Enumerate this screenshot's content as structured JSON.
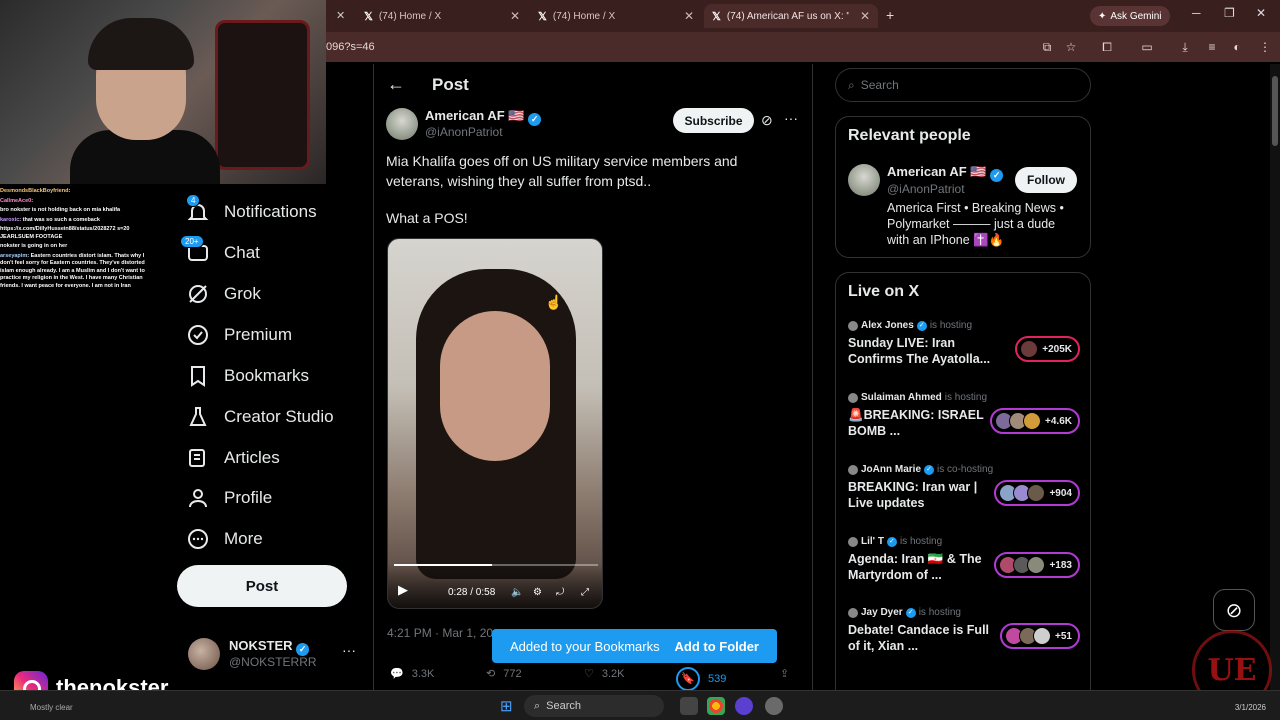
{
  "browser": {
    "tabs": [
      {
        "label": "(74) Home / X"
      },
      {
        "label": "(74) Home / X"
      },
      {
        "label": "(74) American AF us on X: \"Mia"
      }
    ],
    "url_fragment": "096?s=46",
    "gemini_label": "Ask Gemini"
  },
  "stream_chat": [
    {
      "user": "DesmondsBlackBoyfriend",
      "text": ""
    },
    {
      "user": "CallmeAce0",
      "text": ""
    },
    {
      "user": "",
      "text": "bro nokster is not holding back on mia khalifa"
    },
    {
      "user": "karoxic",
      "text": "that was so such a comeback"
    },
    {
      "user": "",
      "text": "https://x.com/DillyHussein88/status/2028272 s=20 JEARLSUEM FOOTAGE"
    },
    {
      "user": "",
      "text": "nokster is going in on her"
    },
    {
      "user": "arseyapim",
      "text": "Eastern countries distort islam. Thats why I don't feel sorry for Eastern countries. They've distorted islam enough already. I am a Muslim and I don't want to practice my religion in the West. I have many Christian friends. I want peace for everyone. I am not in Iran"
    }
  ],
  "nav": {
    "items": [
      {
        "label": "Notifications",
        "icon": "bell-icon",
        "badge": "4"
      },
      {
        "label": "Chat",
        "icon": "chat-icon",
        "badge": "20+"
      },
      {
        "label": "Grok",
        "icon": "grok-icon",
        "badge": ""
      },
      {
        "label": "Premium",
        "icon": "premium-icon",
        "badge": ""
      },
      {
        "label": "Bookmarks",
        "icon": "bookmark-icon",
        "badge": ""
      },
      {
        "label": "Creator Studio",
        "icon": "flask-icon",
        "badge": ""
      },
      {
        "label": "Articles",
        "icon": "articles-icon",
        "badge": ""
      },
      {
        "label": "Profile",
        "icon": "person-icon",
        "badge": ""
      },
      {
        "label": "More",
        "icon": "more-icon",
        "badge": ""
      }
    ],
    "post_button": "Post",
    "account": {
      "name": "NOKSTER",
      "handle": "@NOKSTERRR"
    }
  },
  "post": {
    "header": "Post",
    "author": {
      "name": "American AF 🇺🇸",
      "handle": "@iAnonPatriot"
    },
    "subscribe_label": "Subscribe",
    "text_line1": "Mia Khalifa goes off on US military service members and veterans, wishing they all suffer from ptsd..",
    "text_line2": "What a POS!",
    "video": {
      "time": "0:28 / 0:58",
      "progress": 0.48
    },
    "timestamp": "4:21 PM · Mar 1, 20",
    "toast": {
      "message": "Added to your Bookmarks",
      "action": "Add to Folder"
    },
    "stats": {
      "replies": "3.3K",
      "reposts": "772",
      "likes": "3.2K",
      "views": "539"
    }
  },
  "sidebar": {
    "search_placeholder": "Search",
    "relevant_title": "Relevant people",
    "relevant": {
      "name": "American AF 🇺🇸",
      "handle": "@iAnonPatriot",
      "follow_label": "Follow",
      "bio": "America First • Breaking News • Polymarket ——— just a dude with an IPhone ✝️🔥"
    },
    "live_title": "Live on X",
    "live": [
      {
        "host": "Alex Jones",
        "role": "is hosting",
        "title": "Sunday LIVE: Iran Confirms The Ayatolla...",
        "count": "+205K"
      },
      {
        "host": "Sulaiman Ahmed",
        "role": "is hosting",
        "title": "🚨BREAKING: ISRAEL BOMB ...",
        "count": "+4.6K"
      },
      {
        "host": "JoAnn Marie",
        "role": "is co-hosting",
        "title": "BREAKING: Iran war | Live updates",
        "count": "+904"
      },
      {
        "host": "Lil' T",
        "role": "is hosting",
        "title": "Agenda: Iran 🇮🇷 & The Martyrdom of ...",
        "count": "+183"
      },
      {
        "host": "Jay Dyer",
        "role": "is hosting",
        "title": "Debate! Candace is Full of it, Xian ...",
        "count": "+51"
      }
    ]
  },
  "overlay": {
    "instagram": "thenokster",
    "watermark": "UE"
  },
  "taskbar": {
    "search": "Search",
    "status": "Mostly clear",
    "clock": "3/1/2026"
  }
}
